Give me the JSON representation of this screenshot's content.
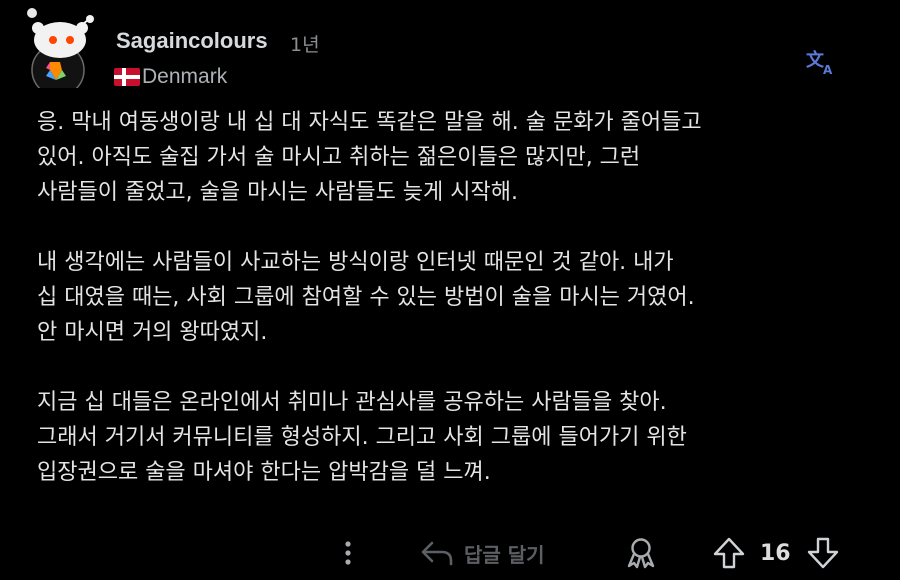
{
  "comment": {
    "author": "Sagaincolours",
    "age": "1년",
    "flair": "Denmark",
    "paragraphs": [
      "응. 막내 여동생이랑 내 십 대 자식도 똑같은 말을 해. 술 문화가 줄어들고\n있어. 아직도 술집 가서 술 마시고 취하는 젊은이들은 많지만, 그런\n사람들이 줄었고, 술을 마시는 사람들도 늦게 시작해.",
      "내 생각에는 사람들이 사교하는 방식이랑 인터넷 때문인 것 같아. 내가\n십 대였을 때는, 사회 그룹에 참여할 수 있는 방법이 술을 마시는 거였어.\n안 마시면 거의 왕따였지.",
      "지금 십 대들은 온라인에서 취미나 관심사를 공유하는 사람들을 찾아.\n그래서 거기서 커뮤니티를 형성하지. 그리고 사회 그룹에 들어가기 위한\n입장권으로 술을 마셔야 한다는 압박감을 덜 느껴."
    ]
  },
  "actions": {
    "reply_label": "답글 달기",
    "score": "16"
  },
  "icons": {
    "avatar": "snoo-avatar-icon",
    "flag": "denmark-flag-icon",
    "translate": "translate-icon",
    "more": "more-vertical-icon",
    "reply": "reply-arrow-icon",
    "award": "award-icon",
    "upvote": "upvote-icon",
    "downvote": "downvote-icon"
  },
  "colors": {
    "background": "#000000",
    "translate": "#5a7bd9",
    "flag_red": "#c8102e"
  }
}
